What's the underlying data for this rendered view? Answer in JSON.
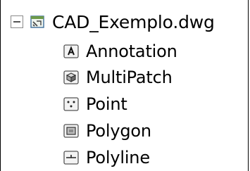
{
  "tree": {
    "root": {
      "label": "CAD_Exemplo.dwg",
      "icon": "cad-file-icon",
      "toggle_state": "expanded"
    },
    "children": [
      {
        "label": "Annotation",
        "icon": "annotation-icon"
      },
      {
        "label": "MultiPatch",
        "icon": "multipatch-icon"
      },
      {
        "label": "Point",
        "icon": "point-icon"
      },
      {
        "label": "Polygon",
        "icon": "polygon-icon"
      },
      {
        "label": "Polyline",
        "icon": "polyline-icon"
      }
    ]
  }
}
